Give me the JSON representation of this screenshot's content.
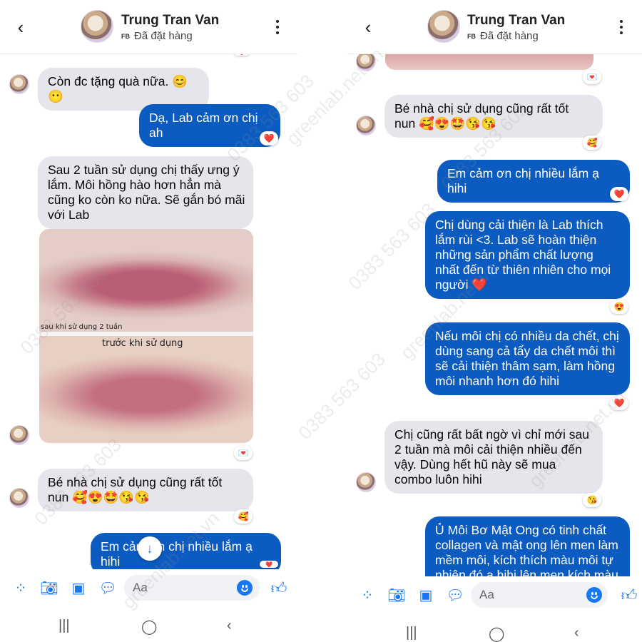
{
  "contact": {
    "name": "Trung Tran Van",
    "source": "FB",
    "status": "Đã đặt hàng"
  },
  "left": {
    "messages": [
      {
        "type": "in",
        "text": "Còn đc tặng quà nữa. 😊😶"
      },
      {
        "type": "out",
        "text": "Dạ, Lab cảm ơn chị ah",
        "reaction": "❤️"
      },
      {
        "type": "in",
        "text": "Sau 2 tuần sử dụng chị thấy ưng ý lắm. Môi hồng hào hơn hẳn mà cũng ko còn ko nữa. Sẽ gắn bó mãi với Lab"
      },
      {
        "type": "photo",
        "caption_after": "sau khi sử dụng 2 tuần",
        "caption_before": "trước khi sử dụng",
        "reaction": "💌"
      },
      {
        "type": "in",
        "text": "Bé nhà chị sử dụng cũng rất tốt nun 🥰😍🤩😘😘",
        "reaction": "🥰"
      },
      {
        "type": "out",
        "text": "Em cảm ơn chị nhiều lắm ạ hihi",
        "reaction": "❤️"
      }
    ]
  },
  "right": {
    "messages": [
      {
        "type": "photo-tail",
        "reaction": "💌"
      },
      {
        "type": "in",
        "text": "Bé nhà chị sử dụng cũng rất tốt nun 🥰😍🤩😘😘",
        "reaction": "🥰"
      },
      {
        "type": "out",
        "text": "Em cảm ơn chị nhiều lắm ạ hihi",
        "reaction": "❤️"
      },
      {
        "type": "out",
        "text": "Chị dùng cải thiện là Lab thích lắm rùi <3. Lab sẽ hoàn thiện những sản phẩm chất lượng nhất đến từ thiên nhiên cho mọi người ❤️",
        "reaction": "😍"
      },
      {
        "type": "out",
        "text": "Nếu môi chị có nhiều da chết, chị dùng sang cả tẩy da chết môi thì sẽ cải thiện thâm sạm, làm hồng môi nhanh hơn đó hihi",
        "reaction": "❤️"
      },
      {
        "type": "in",
        "text": "Chị cũng rất bất ngờ vì chỉ mới sau 2 tuần mà môi cải thiện nhiều đến vậy. Dùng hết hũ này sẽ mua combo luôn hihi",
        "reaction": "😘"
      },
      {
        "type": "out",
        "text": "Ủ Môi Bơ Mật Ong có tinh chất collagen và mật ong lên men làm mềm môi, kích thích màu môi tự nhiên đó ạ hihi lên men kích màu"
      }
    ]
  },
  "composer": {
    "placeholder": "Aa"
  },
  "watermark": {
    "site": "greenlab.net.vn",
    "phone": "0383 563 603"
  },
  "colors": {
    "outgoing": "#0c5bc0",
    "incoming": "#e4e6eb",
    "accent": "#1877f2"
  }
}
